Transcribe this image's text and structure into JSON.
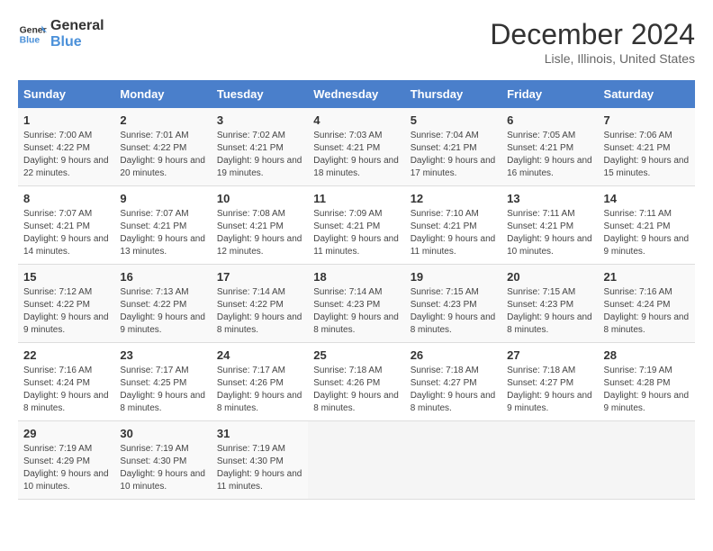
{
  "header": {
    "logo_text_general": "General",
    "logo_text_blue": "Blue",
    "month_title": "December 2024",
    "location": "Lisle, Illinois, United States"
  },
  "days_of_week": [
    "Sunday",
    "Monday",
    "Tuesday",
    "Wednesday",
    "Thursday",
    "Friday",
    "Saturday"
  ],
  "weeks": [
    [
      {
        "day": "1",
        "sunrise": "7:00 AM",
        "sunset": "4:22 PM",
        "daylight": "9 hours and 22 minutes."
      },
      {
        "day": "2",
        "sunrise": "7:01 AM",
        "sunset": "4:22 PM",
        "daylight": "9 hours and 20 minutes."
      },
      {
        "day": "3",
        "sunrise": "7:02 AM",
        "sunset": "4:21 PM",
        "daylight": "9 hours and 19 minutes."
      },
      {
        "day": "4",
        "sunrise": "7:03 AM",
        "sunset": "4:21 PM",
        "daylight": "9 hours and 18 minutes."
      },
      {
        "day": "5",
        "sunrise": "7:04 AM",
        "sunset": "4:21 PM",
        "daylight": "9 hours and 17 minutes."
      },
      {
        "day": "6",
        "sunrise": "7:05 AM",
        "sunset": "4:21 PM",
        "daylight": "9 hours and 16 minutes."
      },
      {
        "day": "7",
        "sunrise": "7:06 AM",
        "sunset": "4:21 PM",
        "daylight": "9 hours and 15 minutes."
      }
    ],
    [
      {
        "day": "8",
        "sunrise": "7:07 AM",
        "sunset": "4:21 PM",
        "daylight": "9 hours and 14 minutes."
      },
      {
        "day": "9",
        "sunrise": "7:07 AM",
        "sunset": "4:21 PM",
        "daylight": "9 hours and 13 minutes."
      },
      {
        "day": "10",
        "sunrise": "7:08 AM",
        "sunset": "4:21 PM",
        "daylight": "9 hours and 12 minutes."
      },
      {
        "day": "11",
        "sunrise": "7:09 AM",
        "sunset": "4:21 PM",
        "daylight": "9 hours and 11 minutes."
      },
      {
        "day": "12",
        "sunrise": "7:10 AM",
        "sunset": "4:21 PM",
        "daylight": "9 hours and 11 minutes."
      },
      {
        "day": "13",
        "sunrise": "7:11 AM",
        "sunset": "4:21 PM",
        "daylight": "9 hours and 10 minutes."
      },
      {
        "day": "14",
        "sunrise": "7:11 AM",
        "sunset": "4:21 PM",
        "daylight": "9 hours and 9 minutes."
      }
    ],
    [
      {
        "day": "15",
        "sunrise": "7:12 AM",
        "sunset": "4:22 PM",
        "daylight": "9 hours and 9 minutes."
      },
      {
        "day": "16",
        "sunrise": "7:13 AM",
        "sunset": "4:22 PM",
        "daylight": "9 hours and 9 minutes."
      },
      {
        "day": "17",
        "sunrise": "7:14 AM",
        "sunset": "4:22 PM",
        "daylight": "9 hours and 8 minutes."
      },
      {
        "day": "18",
        "sunrise": "7:14 AM",
        "sunset": "4:23 PM",
        "daylight": "9 hours and 8 minutes."
      },
      {
        "day": "19",
        "sunrise": "7:15 AM",
        "sunset": "4:23 PM",
        "daylight": "9 hours and 8 minutes."
      },
      {
        "day": "20",
        "sunrise": "7:15 AM",
        "sunset": "4:23 PM",
        "daylight": "9 hours and 8 minutes."
      },
      {
        "day": "21",
        "sunrise": "7:16 AM",
        "sunset": "4:24 PM",
        "daylight": "9 hours and 8 minutes."
      }
    ],
    [
      {
        "day": "22",
        "sunrise": "7:16 AM",
        "sunset": "4:24 PM",
        "daylight": "9 hours and 8 minutes."
      },
      {
        "day": "23",
        "sunrise": "7:17 AM",
        "sunset": "4:25 PM",
        "daylight": "9 hours and 8 minutes."
      },
      {
        "day": "24",
        "sunrise": "7:17 AM",
        "sunset": "4:26 PM",
        "daylight": "9 hours and 8 minutes."
      },
      {
        "day": "25",
        "sunrise": "7:18 AM",
        "sunset": "4:26 PM",
        "daylight": "9 hours and 8 minutes."
      },
      {
        "day": "26",
        "sunrise": "7:18 AM",
        "sunset": "4:27 PM",
        "daylight": "9 hours and 8 minutes."
      },
      {
        "day": "27",
        "sunrise": "7:18 AM",
        "sunset": "4:27 PM",
        "daylight": "9 hours and 9 minutes."
      },
      {
        "day": "28",
        "sunrise": "7:19 AM",
        "sunset": "4:28 PM",
        "daylight": "9 hours and 9 minutes."
      }
    ],
    [
      {
        "day": "29",
        "sunrise": "7:19 AM",
        "sunset": "4:29 PM",
        "daylight": "9 hours and 10 minutes."
      },
      {
        "day": "30",
        "sunrise": "7:19 AM",
        "sunset": "4:30 PM",
        "daylight": "9 hours and 10 minutes."
      },
      {
        "day": "31",
        "sunrise": "7:19 AM",
        "sunset": "4:30 PM",
        "daylight": "9 hours and 11 minutes."
      },
      null,
      null,
      null,
      null
    ]
  ]
}
